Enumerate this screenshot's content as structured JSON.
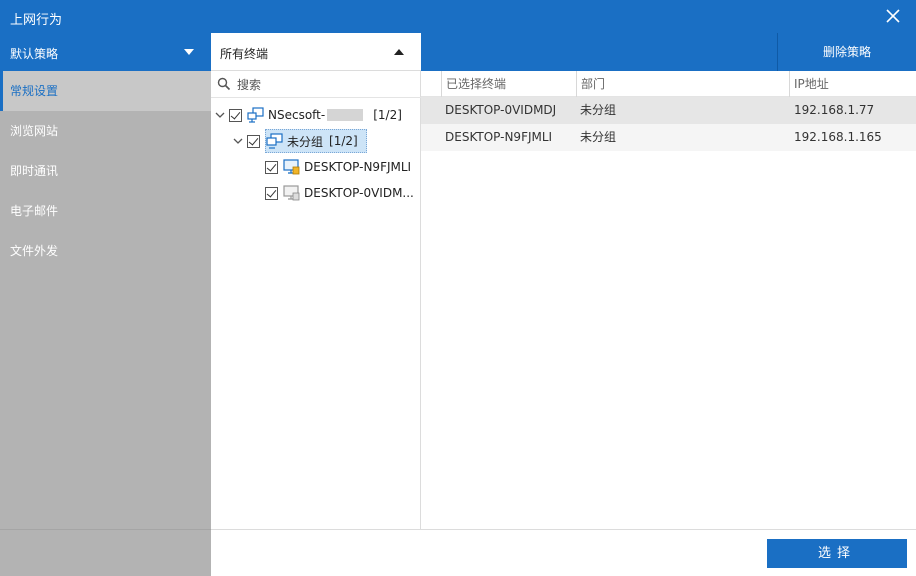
{
  "window": {
    "title": "上网行为"
  },
  "sidebar": {
    "policy_dropdown": "默认策略",
    "items": [
      {
        "label": "常规设置",
        "active": true
      },
      {
        "label": "浏览网站",
        "active": false
      },
      {
        "label": "即时通讯",
        "active": false
      },
      {
        "label": "电子邮件",
        "active": false
      },
      {
        "label": "文件外发",
        "active": false
      }
    ]
  },
  "terminals": {
    "dropdown_label": "所有终端",
    "search_placeholder": "搜索",
    "tree": {
      "root": {
        "label": "NSecsoft-",
        "count": "[1/2]",
        "checked": true
      },
      "group": {
        "label": "未分组",
        "count": "[1/2]",
        "checked": true
      },
      "devices": [
        {
          "label": "DESKTOP-N9FJMLI",
          "checked": true,
          "online": true
        },
        {
          "label": "DESKTOP-0VIDM...",
          "checked": true,
          "online": false
        }
      ]
    }
  },
  "selected_table": {
    "delete_button": "删除策略",
    "columns": [
      "已选择终端",
      "部门",
      "IP地址"
    ],
    "rows": [
      {
        "terminal": "DESKTOP-0VIDMDJ",
        "department": "未分组",
        "ip": "192.168.1.77"
      },
      {
        "terminal": "DESKTOP-N9FJMLI",
        "department": "未分组",
        "ip": "192.168.1.165"
      }
    ]
  },
  "footer": {
    "select_button": "选择"
  },
  "colors": {
    "accent": "#1a6fc4",
    "sidebar_bg": "#b3b3b3",
    "selection": "#cde4f7"
  }
}
